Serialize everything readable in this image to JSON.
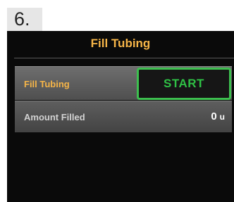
{
  "step": {
    "number": "6."
  },
  "screen": {
    "title": "Fill Tubing",
    "rows": {
      "fill_tubing": {
        "label": "Fill Tubing",
        "button_label": "START"
      },
      "amount_filled": {
        "label": "Amount Filled",
        "value": "0",
        "unit": "u"
      }
    }
  },
  "colors": {
    "screen_background": "#0a0a0a",
    "title": "#f6b548",
    "start_button_border": "#3dbf4f",
    "start_button_text": "#2fc145"
  }
}
